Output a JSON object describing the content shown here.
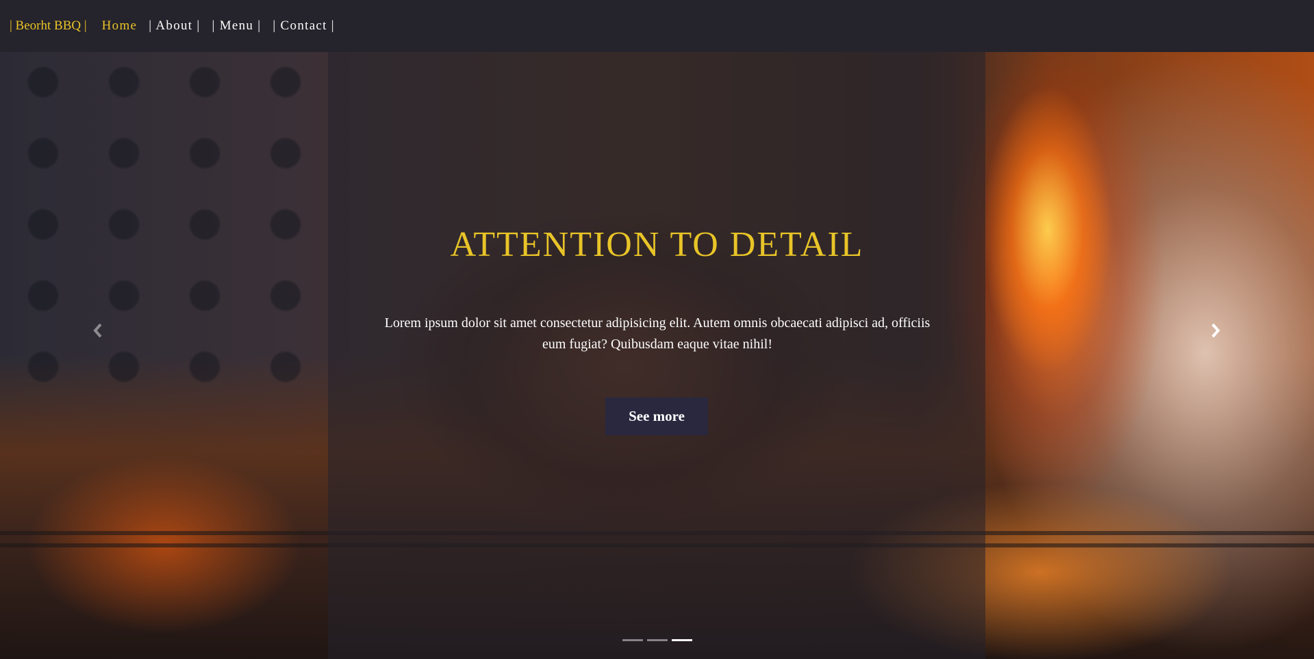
{
  "navbar": {
    "brand": "| Beorht BBQ |",
    "links": [
      {
        "label": "Home",
        "active": true
      },
      {
        "label": "| About |",
        "active": false
      },
      {
        "label": "| Menu |",
        "active": false
      },
      {
        "label": "| Contact |",
        "active": false
      }
    ]
  },
  "hero": {
    "title": "ATTENTION TO DETAIL",
    "text": "Lorem ipsum dolor sit amet consectetur adipisicing elit. Autem omnis obcaecati adipisci ad, officiis eum fugiat? Quibusdam eaque vitae nihil!",
    "button_label": "See more",
    "prev_icon": "chevron-left-icon",
    "next_icon": "chevron-right-icon",
    "slide_count": 3,
    "active_slide": 3
  },
  "colors": {
    "accent": "#e8c428",
    "navbar_bg": "#25232b",
    "button_bg": "#29283f"
  }
}
